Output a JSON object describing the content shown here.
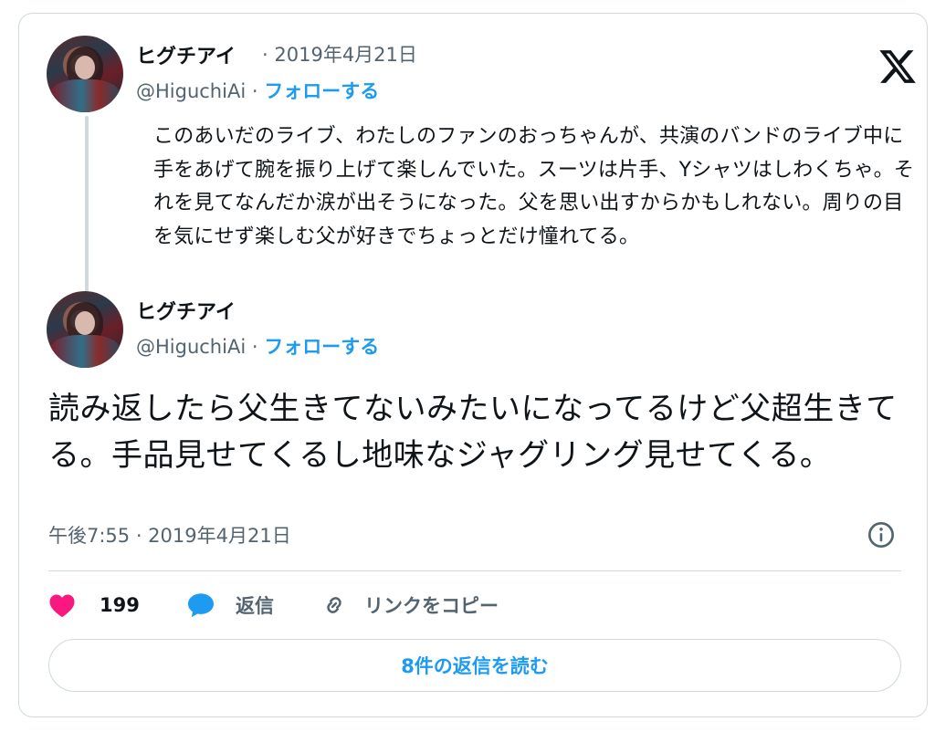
{
  "quoted_tweet": {
    "author_name": "ヒグチアイ",
    "date_sep": "·",
    "date": "2019年4月21日",
    "handle": "@HiguchiAi",
    "handle_sep": "·",
    "follow_label": "フォローする",
    "text": "このあいだのライブ、わたしのファンのおっちゃんが、共演のバンドのライブ中に手をあげて腕を振り上げて楽しんでいた。スーツは片手、Yシャツはしわくちゃ。それを見てなんだか涙が出そうになった。父を思い出すからかもしれない。周りの目を気にせず楽しむ父が好きでちょっとだけ憧れてる。"
  },
  "main_tweet": {
    "author_name": "ヒグチアイ",
    "handle": "@HiguchiAi",
    "handle_sep": "·",
    "follow_label": "フォローする",
    "text": "読み返したら父生きてないみたいになってるけど父超生きてる。手品見せてくるし地味なジャグリング見せてくる。",
    "timestamp": "午後7:55 · 2019年4月21日"
  },
  "actions": {
    "likes_count": "199",
    "reply_label": "返信",
    "copy_link_label": "リンクをコピー"
  },
  "read_replies_label": "8件の返信を読む",
  "colors": {
    "accent": "#1d9bf0",
    "like": "#f91880",
    "secondary_text": "#536471",
    "border": "#cfd9de"
  },
  "icons": [
    "x-logo-icon",
    "info-icon",
    "heart-icon",
    "speech-bubble-icon",
    "link-icon"
  ]
}
